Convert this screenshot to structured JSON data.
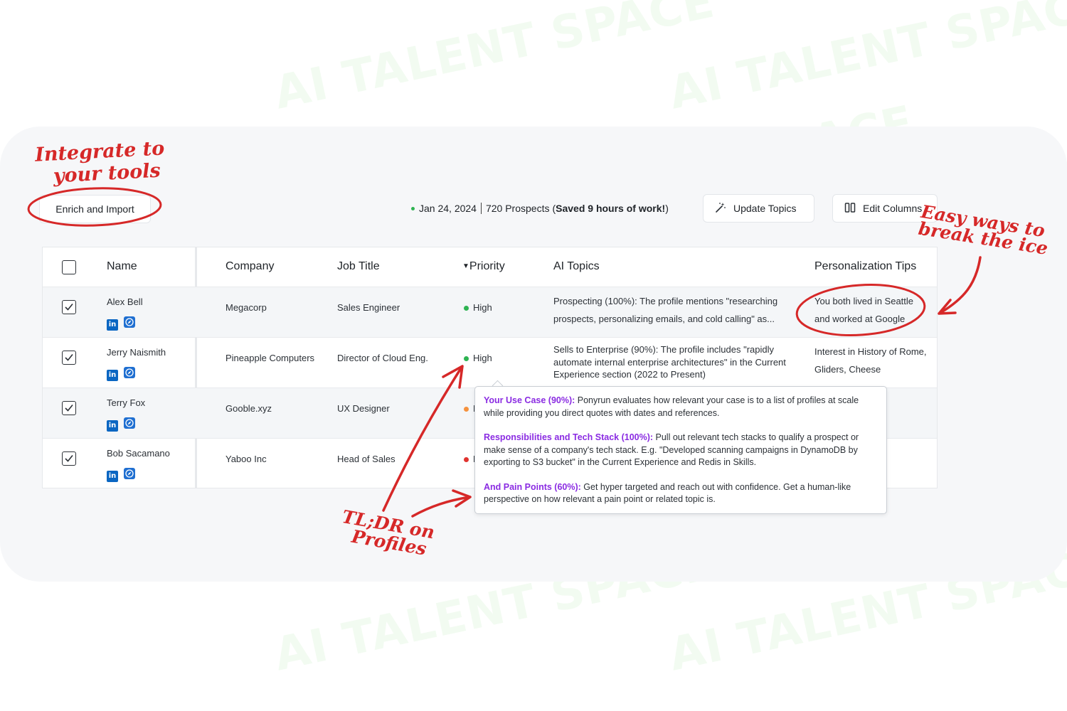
{
  "watermark_text": "AI TALENT SPACE",
  "toolbar": {
    "enrich_label": "Enrich and Import",
    "update_topics_label": "Update Topics",
    "edit_columns_label": "Edit Columns"
  },
  "status": {
    "date": "Jan 24, 2024",
    "prospects": "720 Prospects",
    "saved_prefix": "(",
    "saved_bold": "Saved 9 hours of work!",
    "saved_suffix": ")"
  },
  "table": {
    "headers": {
      "name": "Name",
      "company": "Company",
      "job_title": "Job Title",
      "priority": "Priority",
      "ai_topics": "AI Topics",
      "personalization": "Personalization Tips"
    },
    "rows": [
      {
        "name": "Alex Bell",
        "company": "Megacorp",
        "job_title": "Sales Engineer",
        "priority": "High",
        "ai_topics": "Prospecting (100%): The profile mentions \"researching prospects, personalizing emails, and cold calling\" as...",
        "tips": "You both lived in Seattle and worked at Google"
      },
      {
        "name": "Jerry Naismith",
        "company": "Pineapple Computers",
        "job_title": "Director of Cloud Eng.",
        "priority": "High",
        "ai_topics": "Sells to Enterprise (90%): The profile includes \"rapidly automate internal enterprise architectures\" in the Current Experience section (2022 to Present)",
        "tips": "Interest in History of Rome, Gliders, Cheese"
      },
      {
        "name": "Terry Fox",
        "company": "Gooble.xyz",
        "job_title": "UX Designer",
        "priority": "N"
      },
      {
        "name": "Bob Sacamano",
        "company": "Yaboo Inc",
        "job_title": "Head of Sales",
        "priority": "L"
      }
    ]
  },
  "tooltip": {
    "items": [
      {
        "label": "Your Use Case (90%):",
        "text": " Ponyrun evaluates how relevant your case is to a list of profiles at scale while providing you direct quotes with dates and references."
      },
      {
        "label": "Responsibilities and Tech Stack (100%):",
        "text": " Pull out relevant tech stacks to qualify a prospect or make sense of a company's tech stack. E.g. \"Developed scanning campaigns in DynamoDB by exporting to S3 bucket\" in the Current Experience and Redis in Skills."
      },
      {
        "label": "And Pain Points (60%):",
        "text": " Get hyper targeted and reach out with confidence. Get a human-like perspective on how relevant a pain point or related topic is."
      }
    ]
  },
  "annotations": {
    "integrate_line1": "Integrate to",
    "integrate_line2": "your tools",
    "icebreak_line1": "Easy ways to",
    "icebreak_line2": "break the ice",
    "tldr_line1": "TL;DR on",
    "tldr_line2": "Profiles"
  },
  "colors": {
    "accent_purple": "#8a2be2",
    "annotation_red": "#d62828",
    "priority_high": "#2eb352",
    "priority_medium": "#f5923e",
    "priority_low": "#e0332f",
    "linkedin_blue": "#0a66c2"
  }
}
